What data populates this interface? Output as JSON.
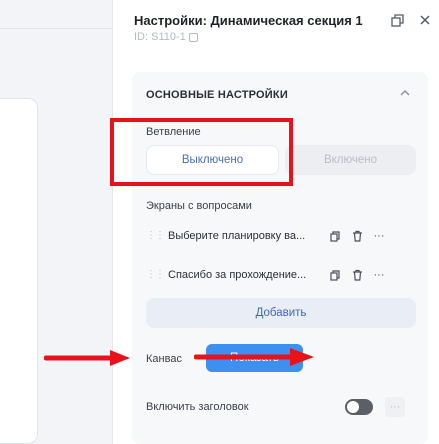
{
  "panel": {
    "title": "Настройки: Динамическая секция 1",
    "id_label": "ID: S110-1",
    "section_title": "ОСНОВНЫЕ НАСТРОЙКИ"
  },
  "branching": {
    "label": "Ветвление",
    "off_label": "Выключено",
    "on_label": "Включено",
    "selected": "Выключено"
  },
  "screens": {
    "label": "Экраны с вопросами",
    "items": [
      {
        "text": "Выберите планировку ва..."
      },
      {
        "text": "Спасибо за прохождение..."
      }
    ],
    "add_label": "Добавить"
  },
  "canvas": {
    "label": "Канвас",
    "button_label": "Показать"
  },
  "header_toggle": {
    "label": "Включить заголовок",
    "enabled": false
  },
  "colors": {
    "accent": "#3d8ff0",
    "annotation": "#e8121b"
  }
}
